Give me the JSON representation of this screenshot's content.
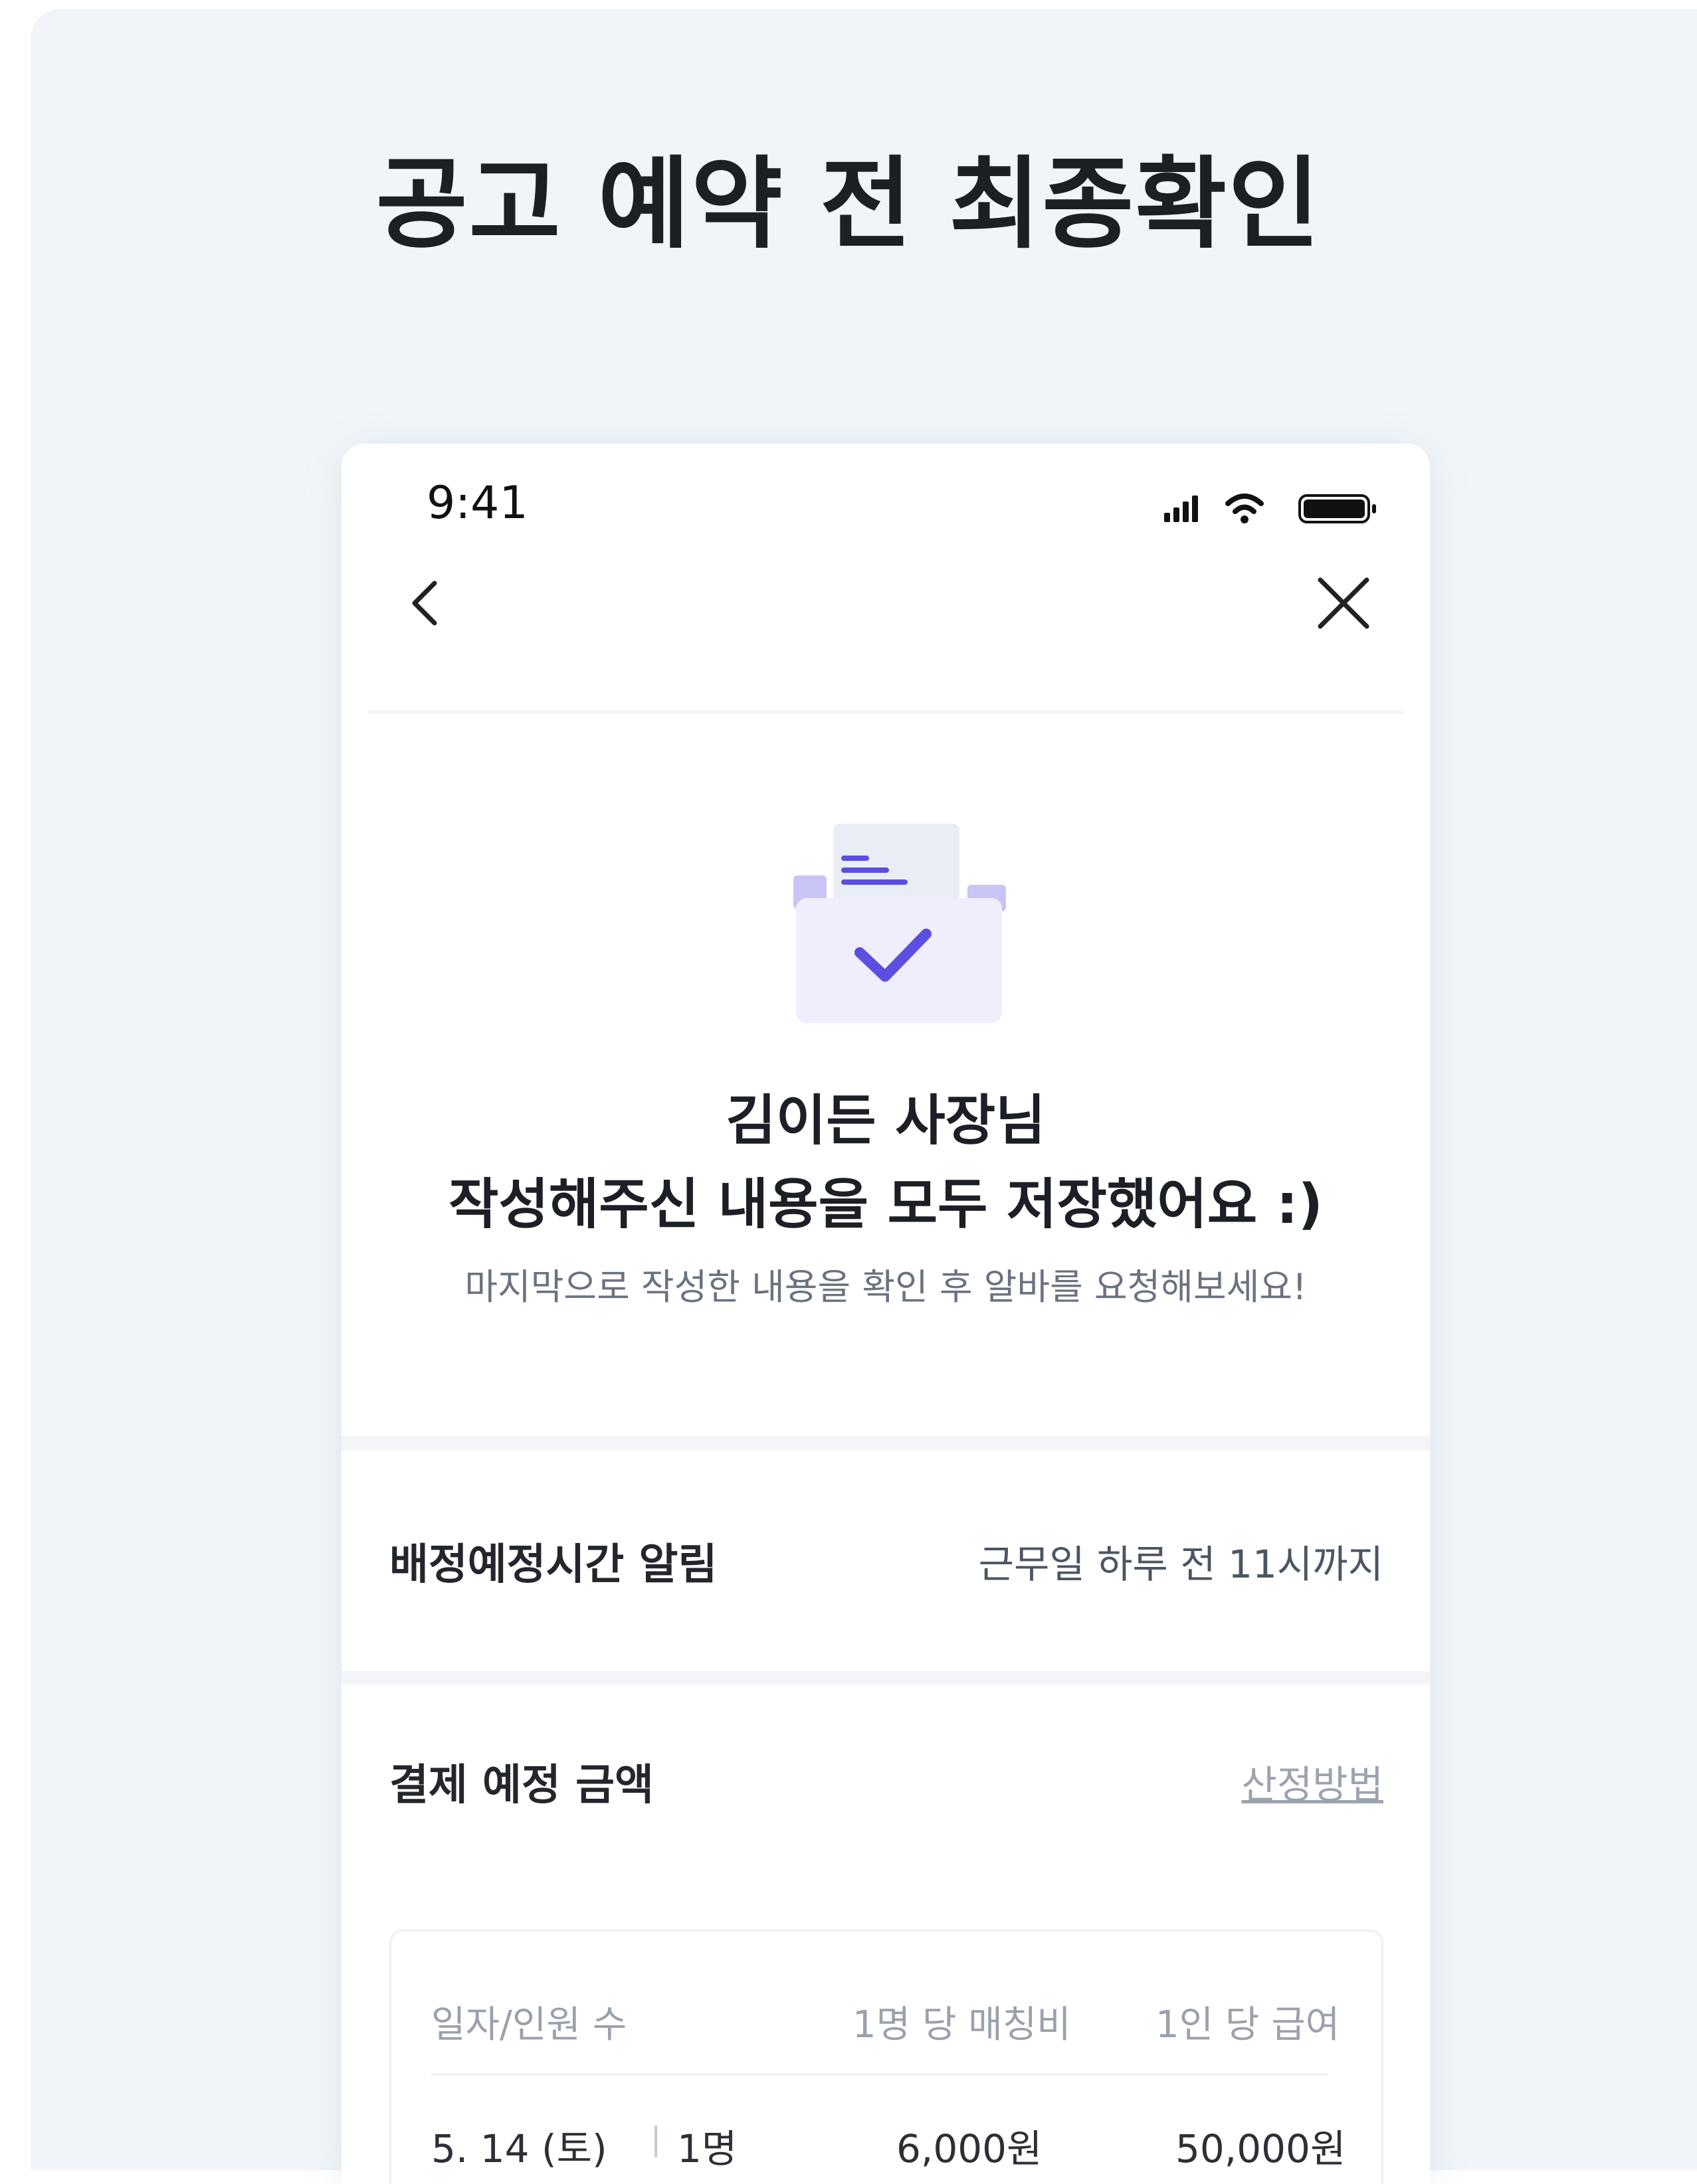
{
  "page_title": "공고 예약 전 최종확인",
  "status_bar": {
    "time": "9:41"
  },
  "nav": {
    "back_icon": "chevron-left-icon",
    "close_icon": "close-icon"
  },
  "confirmation": {
    "illustration": "document-check-illustration",
    "owner_line": "김이든 사장님",
    "saved_line": "작성해주신 내용을 모두 저장했어요 :)",
    "hint": "마지막으로 작성한 내용을 확인 후 알바를 요청해보세요!"
  },
  "assignment_notice": {
    "label": "배정예정시간 알림",
    "value": "근무일 하루 전 11시까지"
  },
  "payment": {
    "label": "결제 예정 금액",
    "method_link": "산정방법",
    "table": {
      "headers": [
        "일자/인원 수",
        "1명 당 매칭비",
        "1인 당 급여"
      ],
      "rows": [
        {
          "date": "5. 14 (토)",
          "separator": "|",
          "headcount": "1명",
          "matching_fee": "6,000원",
          "pay": "50,000원"
        }
      ]
    }
  },
  "colors": {
    "accent": "#5b4fe0",
    "accent_light": "#c9c4f6",
    "background": "#f1f5f9"
  }
}
